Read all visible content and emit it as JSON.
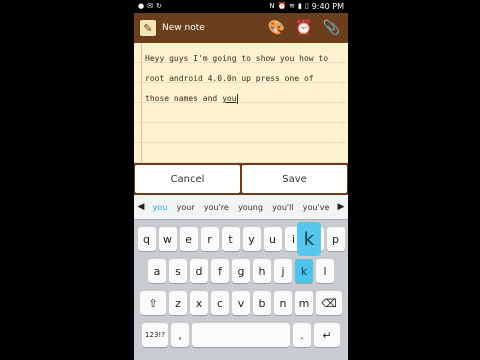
{
  "status_bar": {
    "time": "9:40 PM",
    "left_icons": [
      "record-icon",
      "mail-icon",
      "sync-icon"
    ],
    "right_icons": [
      "n-icon",
      "alarm-icon",
      "wifi-icon",
      "signal-icon",
      "battery-icon"
    ]
  },
  "title_bar": {
    "title": "New note",
    "icons": [
      "palette-icon",
      "alarm-clock-icon",
      "paperclip-icon"
    ]
  },
  "note": {
    "text_before": "Heyy guys I'm going to show you how to root android 4.0.0n up press one of those names and ",
    "current_word": "you"
  },
  "buttons": {
    "cancel": "Cancel",
    "save": "Save"
  },
  "keyboard": {
    "suggestions": [
      "you",
      "your",
      "you're",
      "young",
      "you'll",
      "you've"
    ],
    "rows": [
      [
        "q",
        "w",
        "e",
        "r",
        "t",
        "y",
        "u",
        "i",
        "o",
        "p"
      ],
      [
        "a",
        "s",
        "d",
        "f",
        "g",
        "h",
        "j",
        "k",
        "l"
      ],
      [
        "z",
        "x",
        "c",
        "v",
        "b",
        "n",
        "m"
      ]
    ],
    "popup_key": "k",
    "numeric_key": "123!?",
    "comma_key": ",",
    "period_key": ".",
    "enter_key": "↵"
  },
  "colors": {
    "brown": "#6d3e1c",
    "paper": "#fdf3cf",
    "accent": "#4dc3e8"
  }
}
